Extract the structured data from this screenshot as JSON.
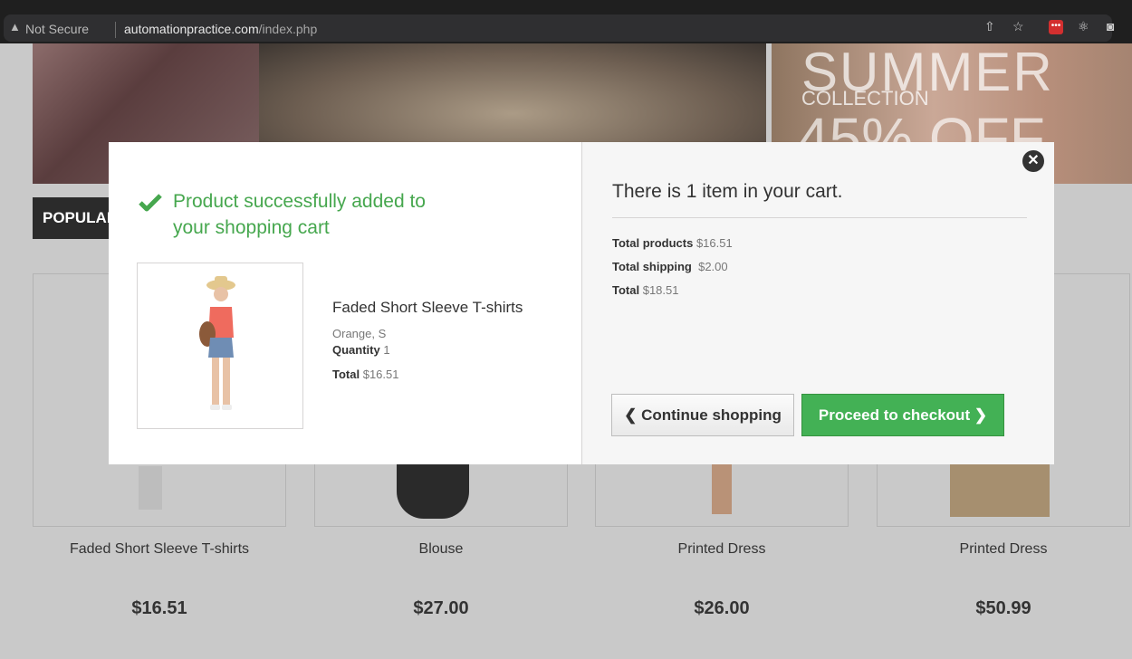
{
  "browser": {
    "security": "Not Secure",
    "domain": "automationpractice.com",
    "path": "/index.php"
  },
  "banner": {
    "headline": "SUMMER",
    "subline": "COLLECTION",
    "discount": "45% OFF"
  },
  "section_title": "POPULAR",
  "products": [
    {
      "name": "Faded Short Sleeve T-shirts",
      "price": "$16.51"
    },
    {
      "name": "Blouse",
      "price": "$27.00"
    },
    {
      "name": "Printed Dress",
      "price": "$26.00"
    },
    {
      "name": "Printed Dress",
      "price": "$50.99"
    }
  ],
  "modal": {
    "success_line1": "Product successfully added to",
    "success_line2": "your shopping cart",
    "item": {
      "name": "Faded Short Sleeve T-shirts",
      "attributes": "Orange, S",
      "quantity_label": "Quantity",
      "quantity": "1",
      "total_label": "Total",
      "total": "$16.51"
    },
    "cart": {
      "title": "There is 1 item in your cart.",
      "total_products_label": "Total products",
      "total_products": "$16.51",
      "total_shipping_label": "Total shipping",
      "total_shipping": "$2.00",
      "total_label": "Total",
      "total": "$18.51"
    },
    "continue_label": "Continue shopping",
    "checkout_label": "Proceed to checkout"
  },
  "colors": {
    "success_green": "#46a74e",
    "checkout_button": "#43b155"
  }
}
